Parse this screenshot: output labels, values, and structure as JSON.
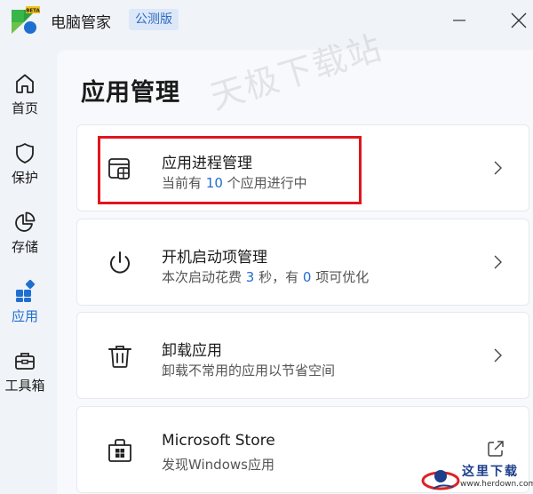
{
  "titlebar": {
    "app_title": "电脑管家",
    "badge": "公测版",
    "logo_badge": "BETA"
  },
  "sidebar": {
    "items": [
      {
        "label": "首页",
        "icon": "home-icon"
      },
      {
        "label": "保护",
        "icon": "shield-icon"
      },
      {
        "label": "存储",
        "icon": "pie-chart-icon"
      },
      {
        "label": "应用",
        "icon": "apps-icon",
        "active": true
      },
      {
        "label": "工具箱",
        "icon": "toolbox-icon"
      }
    ]
  },
  "main": {
    "title": "应用管理",
    "watermark": "天极下载站",
    "cards": [
      {
        "title": "应用进程管理",
        "sub_pre": "当前有 ",
        "sub_num": "10",
        "sub_post": " 个应用进行中",
        "icon": "app-window-icon"
      },
      {
        "title": "开机启动项管理",
        "sub_pre": "本次启动花费 ",
        "sub_num": "3",
        "sub_mid": " 秒，有 ",
        "sub_num2": "0",
        "sub_post": " 项可优化",
        "icon": "power-icon"
      },
      {
        "title": "卸载应用",
        "sub": "卸载不常用的应用以节省空间",
        "icon": "trash-icon"
      },
      {
        "title": "Microsoft Store",
        "sub": "发现Windows应用",
        "icon": "store-icon"
      }
    ]
  },
  "corner": {
    "text": "这里下载",
    "url": "www.herdown.com"
  },
  "colors": {
    "accent": "#1f6fd1",
    "highlight": "#e0161e"
  }
}
